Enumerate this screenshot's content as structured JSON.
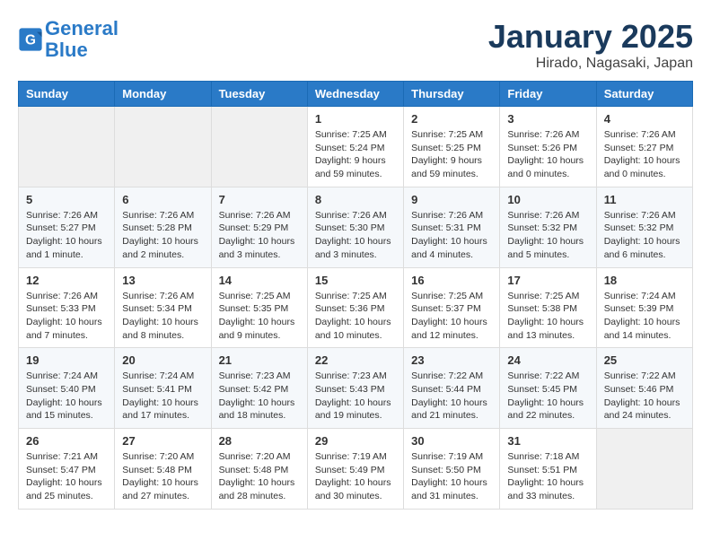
{
  "header": {
    "logo_line1": "General",
    "logo_line2": "Blue",
    "month": "January 2025",
    "location": "Hirado, Nagasaki, Japan"
  },
  "weekdays": [
    "Sunday",
    "Monday",
    "Tuesday",
    "Wednesday",
    "Thursday",
    "Friday",
    "Saturday"
  ],
  "weeks": [
    [
      {
        "day": "",
        "info": ""
      },
      {
        "day": "",
        "info": ""
      },
      {
        "day": "",
        "info": ""
      },
      {
        "day": "1",
        "info": "Sunrise: 7:25 AM\nSunset: 5:24 PM\nDaylight: 9 hours and 59 minutes."
      },
      {
        "day": "2",
        "info": "Sunrise: 7:25 AM\nSunset: 5:25 PM\nDaylight: 9 hours and 59 minutes."
      },
      {
        "day": "3",
        "info": "Sunrise: 7:26 AM\nSunset: 5:26 PM\nDaylight: 10 hours and 0 minutes."
      },
      {
        "day": "4",
        "info": "Sunrise: 7:26 AM\nSunset: 5:27 PM\nDaylight: 10 hours and 0 minutes."
      }
    ],
    [
      {
        "day": "5",
        "info": "Sunrise: 7:26 AM\nSunset: 5:27 PM\nDaylight: 10 hours and 1 minute."
      },
      {
        "day": "6",
        "info": "Sunrise: 7:26 AM\nSunset: 5:28 PM\nDaylight: 10 hours and 2 minutes."
      },
      {
        "day": "7",
        "info": "Sunrise: 7:26 AM\nSunset: 5:29 PM\nDaylight: 10 hours and 3 minutes."
      },
      {
        "day": "8",
        "info": "Sunrise: 7:26 AM\nSunset: 5:30 PM\nDaylight: 10 hours and 3 minutes."
      },
      {
        "day": "9",
        "info": "Sunrise: 7:26 AM\nSunset: 5:31 PM\nDaylight: 10 hours and 4 minutes."
      },
      {
        "day": "10",
        "info": "Sunrise: 7:26 AM\nSunset: 5:32 PM\nDaylight: 10 hours and 5 minutes."
      },
      {
        "day": "11",
        "info": "Sunrise: 7:26 AM\nSunset: 5:32 PM\nDaylight: 10 hours and 6 minutes."
      }
    ],
    [
      {
        "day": "12",
        "info": "Sunrise: 7:26 AM\nSunset: 5:33 PM\nDaylight: 10 hours and 7 minutes."
      },
      {
        "day": "13",
        "info": "Sunrise: 7:26 AM\nSunset: 5:34 PM\nDaylight: 10 hours and 8 minutes."
      },
      {
        "day": "14",
        "info": "Sunrise: 7:25 AM\nSunset: 5:35 PM\nDaylight: 10 hours and 9 minutes."
      },
      {
        "day": "15",
        "info": "Sunrise: 7:25 AM\nSunset: 5:36 PM\nDaylight: 10 hours and 10 minutes."
      },
      {
        "day": "16",
        "info": "Sunrise: 7:25 AM\nSunset: 5:37 PM\nDaylight: 10 hours and 12 minutes."
      },
      {
        "day": "17",
        "info": "Sunrise: 7:25 AM\nSunset: 5:38 PM\nDaylight: 10 hours and 13 minutes."
      },
      {
        "day": "18",
        "info": "Sunrise: 7:24 AM\nSunset: 5:39 PM\nDaylight: 10 hours and 14 minutes."
      }
    ],
    [
      {
        "day": "19",
        "info": "Sunrise: 7:24 AM\nSunset: 5:40 PM\nDaylight: 10 hours and 15 minutes."
      },
      {
        "day": "20",
        "info": "Sunrise: 7:24 AM\nSunset: 5:41 PM\nDaylight: 10 hours and 17 minutes."
      },
      {
        "day": "21",
        "info": "Sunrise: 7:23 AM\nSunset: 5:42 PM\nDaylight: 10 hours and 18 minutes."
      },
      {
        "day": "22",
        "info": "Sunrise: 7:23 AM\nSunset: 5:43 PM\nDaylight: 10 hours and 19 minutes."
      },
      {
        "day": "23",
        "info": "Sunrise: 7:22 AM\nSunset: 5:44 PM\nDaylight: 10 hours and 21 minutes."
      },
      {
        "day": "24",
        "info": "Sunrise: 7:22 AM\nSunset: 5:45 PM\nDaylight: 10 hours and 22 minutes."
      },
      {
        "day": "25",
        "info": "Sunrise: 7:22 AM\nSunset: 5:46 PM\nDaylight: 10 hours and 24 minutes."
      }
    ],
    [
      {
        "day": "26",
        "info": "Sunrise: 7:21 AM\nSunset: 5:47 PM\nDaylight: 10 hours and 25 minutes."
      },
      {
        "day": "27",
        "info": "Sunrise: 7:20 AM\nSunset: 5:48 PM\nDaylight: 10 hours and 27 minutes."
      },
      {
        "day": "28",
        "info": "Sunrise: 7:20 AM\nSunset: 5:48 PM\nDaylight: 10 hours and 28 minutes."
      },
      {
        "day": "29",
        "info": "Sunrise: 7:19 AM\nSunset: 5:49 PM\nDaylight: 10 hours and 30 minutes."
      },
      {
        "day": "30",
        "info": "Sunrise: 7:19 AM\nSunset: 5:50 PM\nDaylight: 10 hours and 31 minutes."
      },
      {
        "day": "31",
        "info": "Sunrise: 7:18 AM\nSunset: 5:51 PM\nDaylight: 10 hours and 33 minutes."
      },
      {
        "day": "",
        "info": ""
      }
    ]
  ]
}
